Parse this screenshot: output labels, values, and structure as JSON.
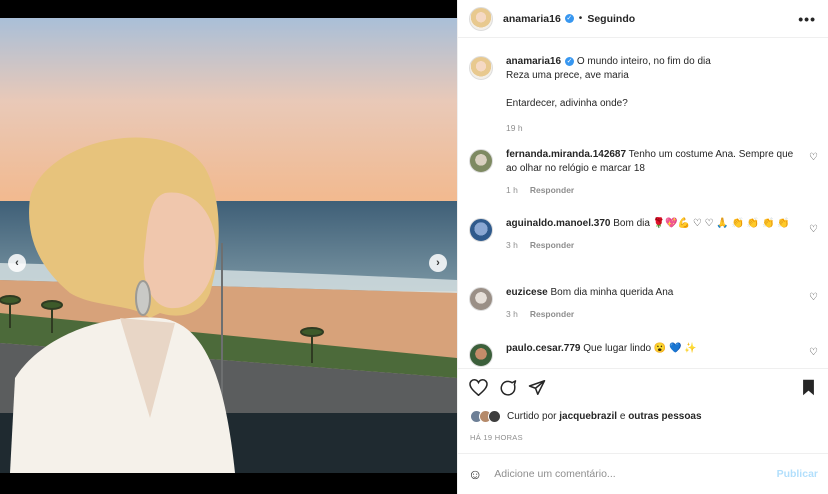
{
  "post": {
    "username": "anamaria16",
    "follow_status": "Seguindo",
    "separator": "•",
    "more_label": "•••",
    "verified_mark": "✓"
  },
  "caption": {
    "username": "anamaria16",
    "line1": "O mundo inteiro, no fim do dia",
    "line2": "Reza uma prece, ave maria",
    "line3": "Entardecer, adivinha onde?",
    "time": "19 h"
  },
  "comments": [
    {
      "username": "fernanda.miranda.142687",
      "text": "Tenho um costume Ana. Sempre que ao olhar no relógio e marcar 18",
      "time": "1 h",
      "reply": "Responder"
    },
    {
      "username": "aguinaldo.manoel.370",
      "text": "Bom dia 🌹💖💪 ♡ ♡ 🙏 👏 👏 👏 👏",
      "time": "3 h",
      "reply": "Responder"
    },
    {
      "username": "euzicese",
      "text": "Bom dia minha querida Ana",
      "time": "3 h",
      "reply": "Responder"
    },
    {
      "username": "paulo.cesar.779",
      "text": "Que lugar lindo 😮 💙 ✨",
      "time": "",
      "reply": ""
    }
  ],
  "likes": {
    "prefix": "Curtido por",
    "user": "jacquebrazil",
    "middle": "e",
    "others": "outras pessoas"
  },
  "timestamp": "HÁ 19 HORAS",
  "comment_box": {
    "placeholder": "Adicione um comentário...",
    "publish": "Publicar"
  },
  "icons": {
    "heart": "heart-icon",
    "comment": "comment-icon",
    "share": "share-icon",
    "save": "bookmark-icon",
    "emoji": "emoji-icon"
  },
  "colors": {
    "verified": "#3897f0",
    "publish_disabled": "#b2dffc",
    "meta_text": "#8e8e8e"
  },
  "nav": {
    "prev": "‹",
    "next": "›"
  }
}
